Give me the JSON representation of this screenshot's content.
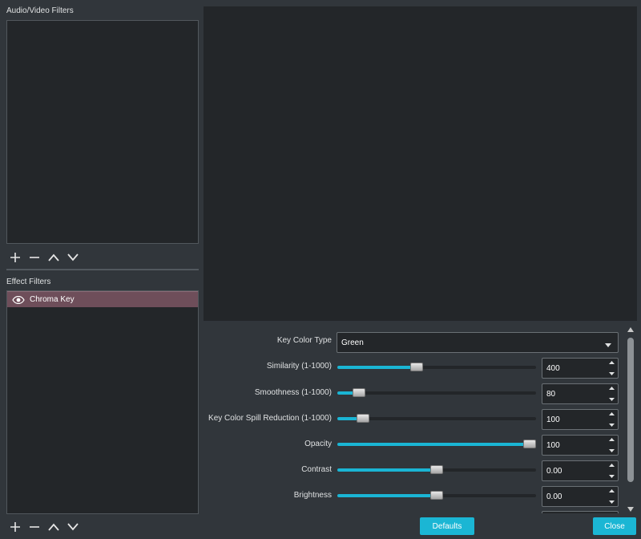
{
  "left": {
    "av_label": "Audio/Video Filters",
    "effect_label": "Effect Filters",
    "effect_items": [
      {
        "label": "Chroma Key",
        "visible": true
      }
    ]
  },
  "properties": [
    {
      "key": "key_color_type",
      "label": "Key Color Type",
      "kind": "combo",
      "value": "Green"
    },
    {
      "key": "similarity",
      "label": "Similarity (1-1000)",
      "kind": "slider",
      "value": "400",
      "fraction": 0.4
    },
    {
      "key": "smoothness",
      "label": "Smoothness (1-1000)",
      "kind": "slider",
      "value": "80",
      "fraction": 0.11
    },
    {
      "key": "spill",
      "label": "Key Color Spill Reduction (1-1000)",
      "kind": "slider",
      "value": "100",
      "fraction": 0.13
    },
    {
      "key": "opacity",
      "label": "Opacity",
      "kind": "slider",
      "value": "100",
      "fraction": 1.0
    },
    {
      "key": "contrast",
      "label": "Contrast",
      "kind": "slider",
      "value": "0.00",
      "fraction": 0.5
    },
    {
      "key": "brightness",
      "label": "Brightness",
      "kind": "slider",
      "value": "0.00",
      "fraction": 0.5
    }
  ],
  "buttons": {
    "defaults": "Defaults",
    "close": "Close"
  },
  "colors": {
    "accent": "#1ab5d4",
    "selected_item": "#6e4e5a",
    "background": "#31363b",
    "panel": "#232629"
  }
}
